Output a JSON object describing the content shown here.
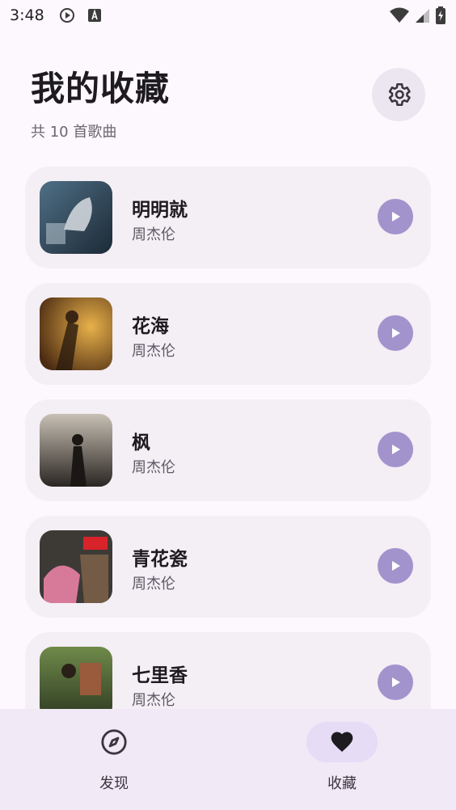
{
  "status": {
    "time": "3:48"
  },
  "header": {
    "title": "我的收藏",
    "subtitle": "共 10 首歌曲"
  },
  "songs": [
    {
      "title": "明明就",
      "artist": "周杰伦"
    },
    {
      "title": "花海",
      "artist": "周杰伦"
    },
    {
      "title": "枫",
      "artist": "周杰伦"
    },
    {
      "title": "青花瓷",
      "artist": "周杰伦"
    },
    {
      "title": "七里香",
      "artist": "周杰伦"
    }
  ],
  "nav": {
    "items": [
      {
        "label": "发现",
        "icon": "compass-icon",
        "active": false
      },
      {
        "label": "收藏",
        "icon": "heart-icon",
        "active": true
      }
    ]
  },
  "colors": {
    "background": "#fdf7fe",
    "card": "#f4eef5",
    "accent": "#a293cd",
    "nav_background": "#f1e9f6"
  }
}
